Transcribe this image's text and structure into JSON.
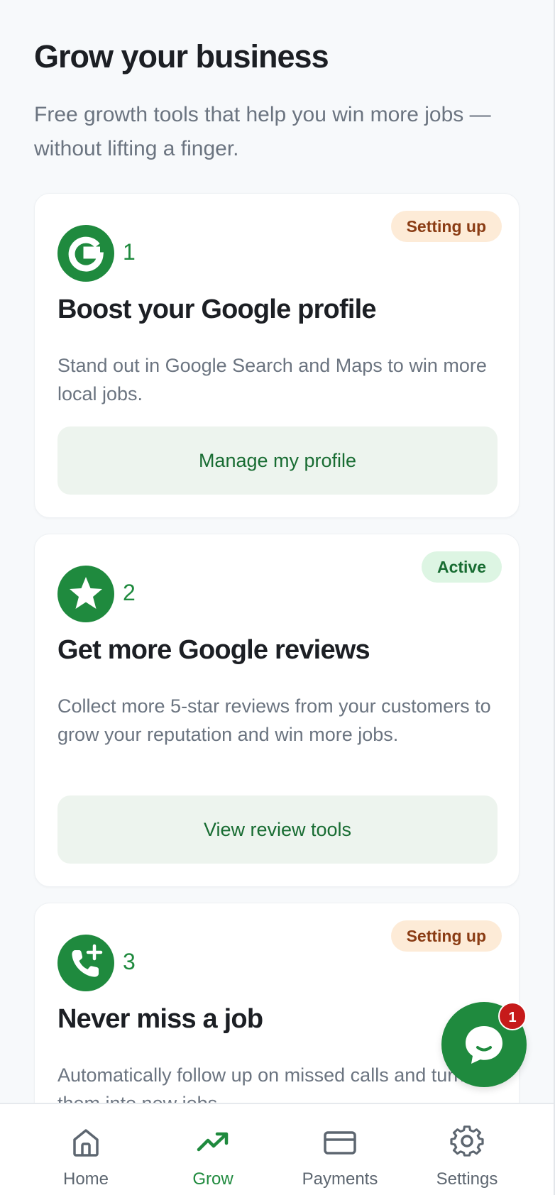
{
  "header": {
    "title": "Grow your business",
    "subtitle": "Free growth tools that help you win more jobs — without lifting a finger."
  },
  "cards": [
    {
      "step": "1",
      "status": "Setting up",
      "title": "Boost your Google profile",
      "description": "Stand out in Google Search and Maps to win more local jobs.",
      "button": "Manage my profile",
      "icon": "google-icon"
    },
    {
      "step": "2",
      "status": "Active",
      "title": "Get more Google reviews",
      "description": "Collect more 5-star reviews from your customers to grow your reputation and win more jobs.",
      "button": "View review tools",
      "icon": "star-icon"
    },
    {
      "step": "3",
      "status": "Setting up",
      "title": "Never miss a job",
      "description": "Automatically follow up on missed calls and turn them into new jobs.",
      "icon": "phone-plus-icon"
    }
  ],
  "chat": {
    "unread_count": "1"
  },
  "nav": {
    "items": [
      {
        "label": "Home",
        "icon": "home-icon"
      },
      {
        "label": "Grow",
        "icon": "trending-up-icon"
      },
      {
        "label": "Payments",
        "icon": "credit-card-icon"
      },
      {
        "label": "Settings",
        "icon": "gear-icon"
      }
    ],
    "active": "Grow"
  },
  "colors": {
    "brand_green": "#1f8a3e",
    "setup_badge_bg": "#fdebd7",
    "setup_badge_text": "#8a3c14",
    "active_badge_bg": "#ddf5e3",
    "notification_red": "#c61a1a"
  }
}
